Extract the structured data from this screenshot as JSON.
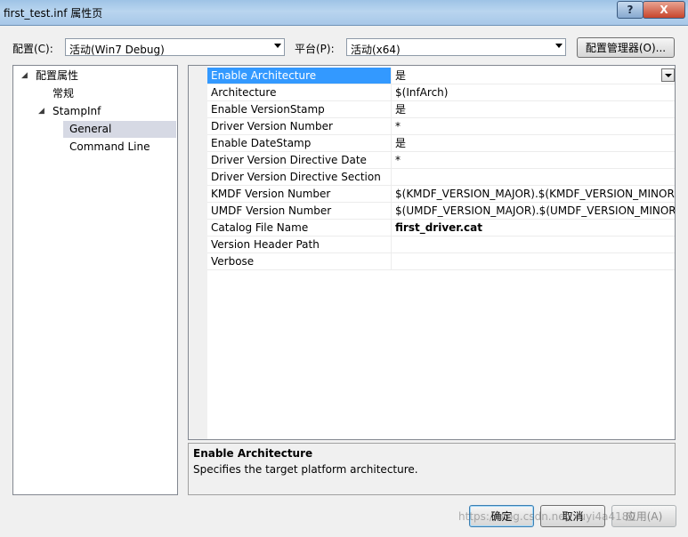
{
  "window": {
    "title": "first_test.inf 属性页",
    "help_label": "?",
    "close_label": "X"
  },
  "toolbar": {
    "config_label": "配置(C):",
    "config_value": "活动(Win7 Debug)",
    "platform_label": "平台(P):",
    "platform_value": "活动(x64)",
    "config_manager_label": "配置管理器(O)..."
  },
  "tree": {
    "nodes": [
      {
        "label": "配置属性",
        "expander": "◢"
      },
      {
        "label": "常规"
      },
      {
        "label": "StampInf",
        "expander": "◢"
      },
      {
        "label": "General",
        "selected": true
      },
      {
        "label": "Command Line"
      }
    ]
  },
  "properties": [
    {
      "name": "Enable Architecture",
      "value": "是",
      "selected": true
    },
    {
      "name": "Architecture",
      "value": "$(InfArch)"
    },
    {
      "name": "Enable VersionStamp",
      "value": "是"
    },
    {
      "name": "Driver Version Number",
      "value": "*"
    },
    {
      "name": "Enable DateStamp",
      "value": "是"
    },
    {
      "name": "Driver Version Directive Date",
      "value": "*"
    },
    {
      "name": "Driver Version Directive Section",
      "value": ""
    },
    {
      "name": "KMDF Version Number",
      "value": "$(KMDF_VERSION_MAJOR).$(KMDF_VERSION_MINOR)"
    },
    {
      "name": "UMDF Version Number",
      "value": "$(UMDF_VERSION_MAJOR).$(UMDF_VERSION_MINOR)"
    },
    {
      "name": "Catalog File Name",
      "value": "first_driver.cat",
      "bold": true
    },
    {
      "name": "Version Header Path",
      "value": ""
    },
    {
      "name": "Verbose",
      "value": ""
    }
  ],
  "description": {
    "title": "Enable Architecture",
    "text": "Specifies the target platform architecture."
  },
  "buttons": {
    "ok": "确定",
    "cancel": "取消",
    "apply": "应用(A)"
  },
  "watermark": "https://blog.csdn.net/xuyi4a4180"
}
